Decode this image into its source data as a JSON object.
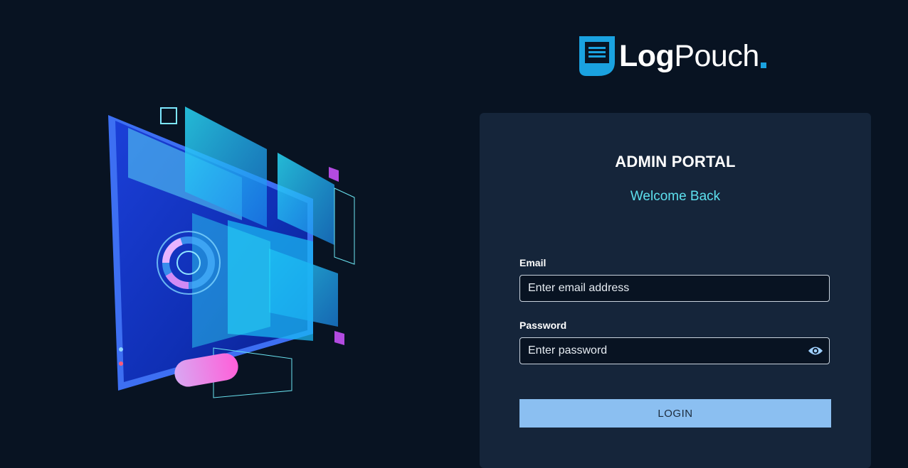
{
  "brand": {
    "name_bold": "Log",
    "name_light": "Pouch",
    "accent_color": "#1aa2e0"
  },
  "hero": {
    "icon": "monitor-illustration"
  },
  "login": {
    "title": "ADMIN PORTAL",
    "subtitle": "Welcome Back",
    "email_label": "Email",
    "email_placeholder": "Enter email address",
    "password_label": "Password",
    "password_placeholder": "Enter password",
    "show_password_icon": "eye-icon",
    "submit_label": "LOGIN"
  },
  "colors": {
    "background": "#081322",
    "card": "#15253a",
    "subtitle": "#5de0ee",
    "button": "#8bbff1"
  }
}
